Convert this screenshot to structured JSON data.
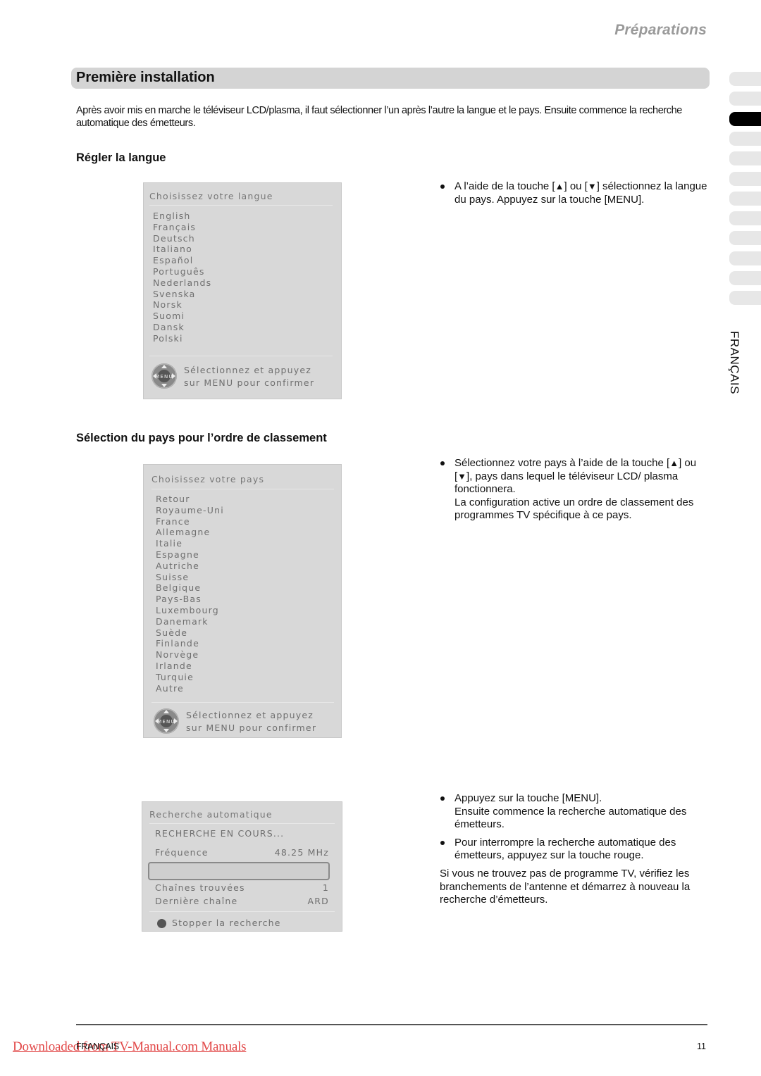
{
  "header": {
    "chapter": "Préparations"
  },
  "section": {
    "title": "Première installation",
    "intro": "Après avoir mis en marche le téléviseur LCD/plasma, il faut sélectionner l’un après l’autre la langue et le pays. Ensuite commence la recherche automatique des émetteurs."
  },
  "language_step": {
    "heading": "Régler la langue",
    "osd": {
      "title": "Choisissez votre langue",
      "items": [
        "English",
        "Français",
        "Deutsch",
        "Italiano",
        "Español",
        "Português",
        "Nederlands",
        "Svenska",
        "Norsk",
        "Suomi",
        "Dansk",
        "Polski"
      ],
      "hint_line1": "Sélectionnez et appuyez",
      "hint_line2": "sur MENU pour confirmer",
      "pad_label": "MENU"
    },
    "bullets": [
      {
        "part1": "A l’aide de la touche [",
        "up": "▲",
        "part2": "] ou [",
        "down": "▼",
        "part3": "] sélectionnez la langue du pays. Appuyez sur la touche [MENU]."
      }
    ]
  },
  "country_step": {
    "heading": "Sélection du pays pour l’ordre de classement",
    "osd": {
      "title": "Choisissez votre pays",
      "items": [
        "Retour",
        "Royaume-Uni",
        "France",
        "Allemagne",
        "Italie",
        "Espagne",
        "Autriche",
        "Suisse",
        "Belgique",
        "Pays-Bas",
        "Luxembourg",
        "Danemark",
        "Suède",
        "Finlande",
        "Norvège",
        "Irlande",
        "Turquie",
        "Autre"
      ],
      "hint_line1": "Sélectionnez et appuyez",
      "hint_line2": "sur MENU pour confirmer",
      "pad_label": "MENU"
    },
    "bullet": {
      "part1": "Sélectionnez votre pays à l’aide de la touche [",
      "up": "▲",
      "part2": "] ou [",
      "down": "▼",
      "part3": "], pays dans lequel le téléviseur LCD/ plasma fonctionnera.",
      "line2": "La configuration active un ordre de classement des programmes TV spécifique à ce pays."
    }
  },
  "search_step": {
    "osd": {
      "title": "Recherche automatique",
      "status": "RECHERCHE EN COURS...",
      "frequency_label": "Fréquence",
      "frequency_value": "48.25 MHz",
      "progress_percent": 0,
      "channels_found_label": "Chaînes trouvées",
      "channels_found_value": "1",
      "last_channel_label": "Dernière chaîne",
      "last_channel_value": "ARD",
      "stop_label": "Stopper la recherche"
    },
    "bullets": [
      {
        "line1": "Appuyez sur la touche [MENU].",
        "line2": "Ensuite commence la recherche automatique des émetteurs."
      },
      {
        "line1": "Pour interrompre la recherche automatique des émetteurs, appuyez sur la touche rouge."
      }
    ],
    "note": "Si vous ne trouvez pas de programme TV, vérifiez les branchements de l’antenne et démarrez à nouveau la recherche d’émetteurs."
  },
  "side_tabs": {
    "count": 12,
    "active_index": 2,
    "language_label": "FRANÇAIS"
  },
  "footer": {
    "download_link": "Downloaded from TV-Manual.com Manuals",
    "language": "FRANÇAIS",
    "page_number": "11"
  }
}
